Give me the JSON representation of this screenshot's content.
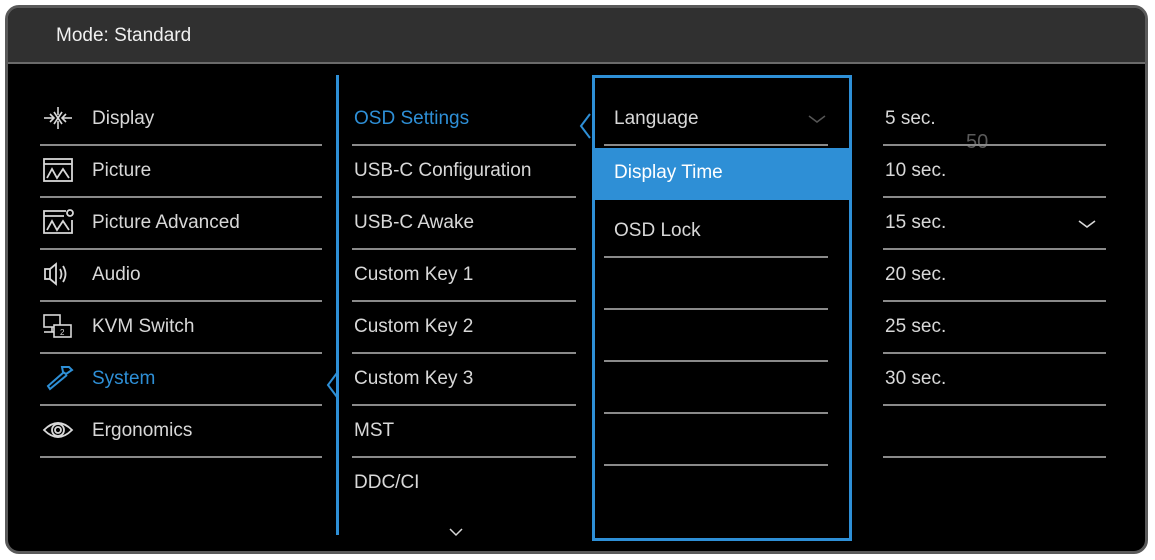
{
  "title": "Mode: Standard",
  "accent": "#2e8fd6",
  "main_menu": [
    {
      "label": "Display",
      "icon": "display-icon"
    },
    {
      "label": "Picture",
      "icon": "picture-icon"
    },
    {
      "label": "Picture Advanced",
      "icon": "picture-advanced-icon"
    },
    {
      "label": "Audio",
      "icon": "audio-icon"
    },
    {
      "label": "KVM Switch",
      "icon": "kvm-switch-icon"
    },
    {
      "label": "System",
      "icon": "system-wrench-icon",
      "active": true
    },
    {
      "label": "Ergonomics",
      "icon": "ergonomics-eye-icon"
    }
  ],
  "system_menu": [
    {
      "label": "OSD Settings",
      "active": true
    },
    {
      "label": "USB-C Configuration"
    },
    {
      "label": "USB-C Awake"
    },
    {
      "label": "Custom Key 1"
    },
    {
      "label": "Custom Key 2"
    },
    {
      "label": "Custom Key 3"
    },
    {
      "label": "MST"
    },
    {
      "label": "DDC/CI"
    }
  ],
  "osd_settings": [
    {
      "label": "Language"
    },
    {
      "label": "Display Time",
      "selected": true
    },
    {
      "label": "OSD Lock"
    },
    {
      "label": ""
    },
    {
      "label": ""
    },
    {
      "label": ""
    },
    {
      "label": ""
    }
  ],
  "display_time_options": [
    {
      "label": "5 sec."
    },
    {
      "label": "10 sec."
    },
    {
      "label": "15 sec.",
      "checked": true
    },
    {
      "label": "20 sec."
    },
    {
      "label": "25 sec."
    },
    {
      "label": "30 sec."
    },
    {
      "label": ""
    }
  ],
  "ghost_value": "50"
}
